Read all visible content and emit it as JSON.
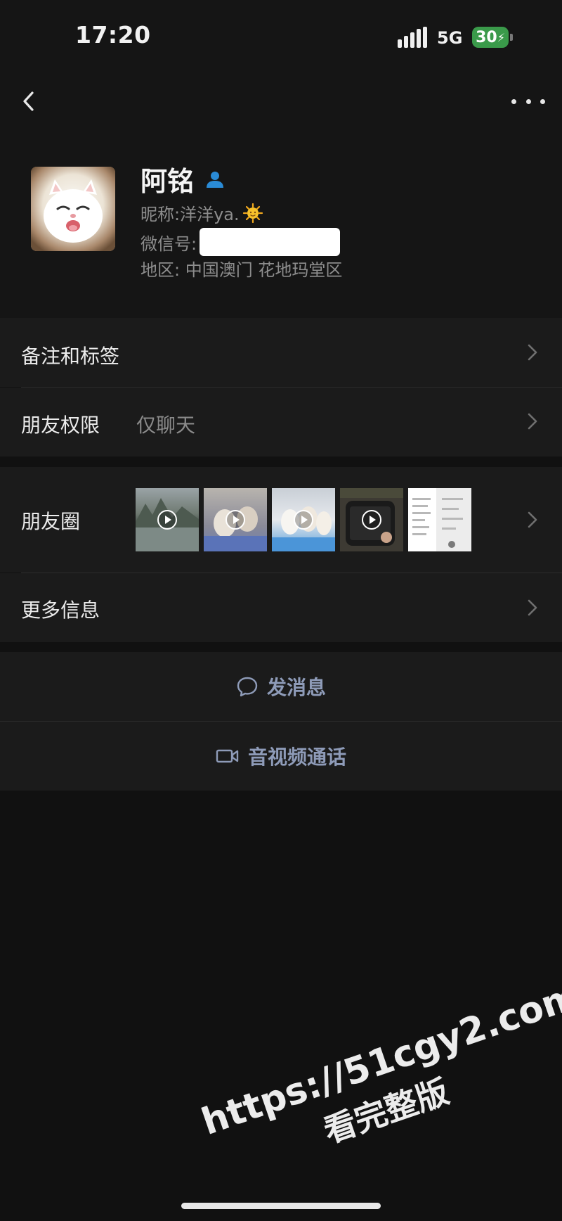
{
  "status_bar": {
    "time": "17:20",
    "network": "5G",
    "battery": "30"
  },
  "nav": {
    "back_icon": "chevron-left-icon",
    "more_icon": "more-dots-icon"
  },
  "profile": {
    "name": "阿铭",
    "nickname_label": "昵称:",
    "nickname": "洋洋ya.",
    "wechat_id_label": "微信号:",
    "region_label": "地区:",
    "region": "中国澳门 花地玛堂区"
  },
  "rows": {
    "remark_tags": "备注和标签",
    "friend_permission": "朋友权限",
    "friend_permission_value": "仅聊天",
    "moments": "朋友圈",
    "more_info": "更多信息"
  },
  "actions": {
    "message": "发消息",
    "video_call": "音视频通话"
  },
  "watermark": {
    "line1": "https://51cgy2.com",
    "line2": "看完整版"
  },
  "colors": {
    "background": "#111111",
    "row": "#1b1b1b",
    "action_text": "#8e9bb8",
    "battery": "#3a9a4a",
    "verified_icon": "#2a8bd6"
  }
}
